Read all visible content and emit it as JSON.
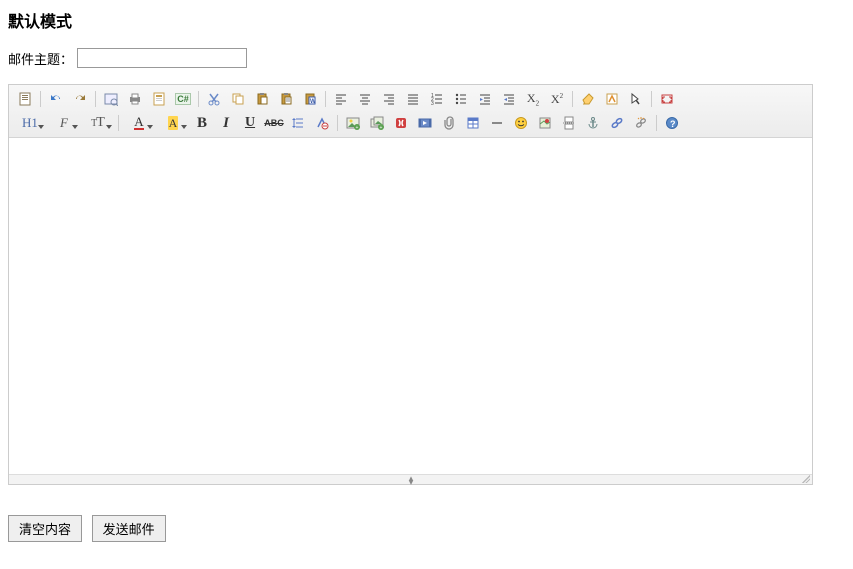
{
  "page": {
    "title": "默认模式"
  },
  "subject": {
    "label": "邮件主题：",
    "value": ""
  },
  "toolbar": {
    "row1": {
      "source": "源码",
      "undo": "撤销",
      "redo": "重做",
      "preview": "预览",
      "print": "打印",
      "template": "模板",
      "codeblock": "代码块",
      "cut": "剪切",
      "copy": "复制",
      "paste": "粘贴",
      "plainpaste": "粘贴纯文本",
      "wordpaste": "从Word粘贴",
      "justifyleft": "左对齐",
      "justifycenter": "居中",
      "justifyright": "右对齐",
      "justifyfull": "两端对齐",
      "orderedlist": "编号",
      "unorderedlist": "项目符号",
      "indent": "增加缩进",
      "outdent": "减少缩进",
      "subscript": "下标",
      "superscript": "上标",
      "clearhtml": "清理HTML",
      "quickformat": "快速排版",
      "selectall": "全选",
      "fullscreen": "全屏"
    },
    "row2": {
      "formatblock": "H1",
      "fontname": "字体",
      "fontsize": "字号",
      "forecolor": "文字颜色",
      "hilitecolor": "背景颜色",
      "bold": "粗体",
      "italic": "斜体",
      "underline": "下划线",
      "strike": "删除线",
      "lineheight": "行距",
      "removeformat": "清除格式",
      "image": "图片",
      "multiimage": "批量图片",
      "flash": "Flash",
      "media": "视音频",
      "insertfile": "文件",
      "table": "表格",
      "hr": "水平线",
      "emoticon": "表情",
      "baidumap": "地图",
      "pagebreak": "分页符",
      "anchor": "锚点",
      "link": "链接",
      "unlink": "取消链接",
      "about": "关于"
    }
  },
  "labels": {
    "formatblock": "H1",
    "fontname": "F",
    "fontsize_big": "T",
    "fontsize_small": "T",
    "forecolor": "A",
    "hilitecolor": "A",
    "bold": "B",
    "italic": "I",
    "underline": "U",
    "strike": "ABC",
    "subscript_x": "X",
    "subscript_2": "2",
    "superscript_x": "X",
    "superscript_2": "2",
    "codeblock": "C#"
  },
  "actions": {
    "clear": "清空内容",
    "send": "发送邮件"
  }
}
